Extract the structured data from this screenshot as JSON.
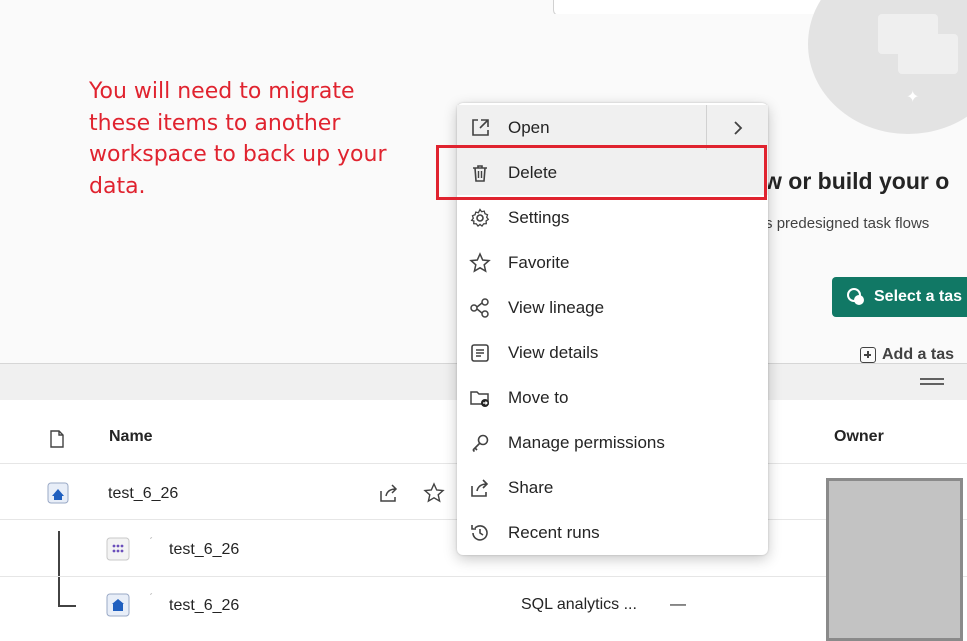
{
  "annotation": {
    "text": "You will need to migrate these items to another workspace to back up your data.",
    "color": "#e0232f"
  },
  "task_flow": {
    "heading": "w or build your o",
    "subtext": "t's predesigned task flows",
    "select_button": "Select a tas",
    "add_button": "Add a tas",
    "accent_color": "#117865"
  },
  "table": {
    "columns": {
      "type_icon": "document-icon",
      "name": "Name",
      "owner": "Owner"
    },
    "rows": [
      {
        "name": "test_6_26",
        "icon": "lakehouse-icon",
        "type": "",
        "level": 0
      },
      {
        "name": "test_6_26",
        "icon": "semantic-model-icon",
        "type": "",
        "level": 1
      },
      {
        "name": "test_6_26",
        "icon": "sql-endpoint-icon",
        "type": "SQL analytics ...",
        "extra": "—",
        "level": 1
      }
    ]
  },
  "context_menu": {
    "items": [
      {
        "label": "Open",
        "icon": "open-external-icon",
        "has_submenu": true
      },
      {
        "label": "Delete",
        "icon": "trash-icon",
        "highlighted": true
      },
      {
        "label": "Settings",
        "icon": "gear-icon"
      },
      {
        "label": "Favorite",
        "icon": "star-icon"
      },
      {
        "label": "View lineage",
        "icon": "lineage-icon"
      },
      {
        "label": "View details",
        "icon": "details-icon"
      },
      {
        "label": "Move to",
        "icon": "folder-move-icon"
      },
      {
        "label": "Manage permissions",
        "icon": "key-icon"
      },
      {
        "label": "Share",
        "icon": "share-icon"
      },
      {
        "label": "Recent runs",
        "icon": "history-icon"
      }
    ]
  }
}
